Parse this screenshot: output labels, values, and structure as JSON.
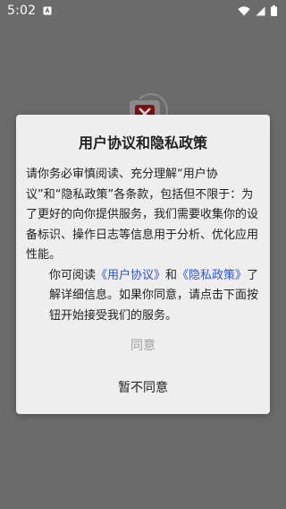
{
  "status_bar": {
    "time": "5:02",
    "notification_icon": "text-box-icon",
    "wifi_icon": "wifi-icon",
    "signal_icon": "cell-signal-icon",
    "battery_icon": "battery-icon"
  },
  "background": {
    "logo_icon": "app-logo-icon",
    "scrim_color": "#6b6b6b"
  },
  "dialog": {
    "title": "用户协议和隐私政策",
    "paragraph1": "请你务必审慎阅读、充分理解“用户协议”和“隐私政策”各条款，包括但不限于：为了更好的向你提供服务，我们需要收集你的设备标识、操作日志等信息用于分析、优化应用性能。",
    "p2_prefix": "你可阅读",
    "user_agreement_link": "《用户协议》",
    "p2_and": "和",
    "privacy_policy_link": "《隐私政策》",
    "p2_suffix": "了解详细信息。如果你同意，请点击下面按钮开始接受我们的服务。",
    "agree_label": "同意",
    "disagree_label": "暂不同意",
    "link_color": "#2b54e8"
  }
}
